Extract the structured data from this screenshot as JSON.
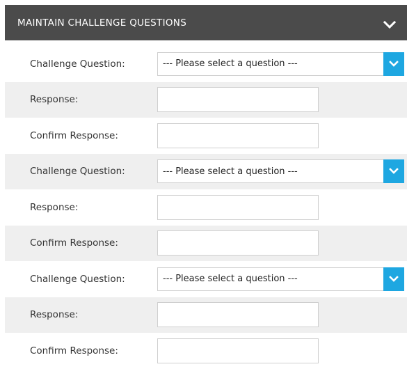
{
  "panel": {
    "title": "MAINTAIN CHALLENGE QUESTIONS",
    "collapse_icon": "chevron-down-icon"
  },
  "questions": [
    {
      "question_label": "Challenge Question:",
      "question_value": "--- Please select a question ---",
      "response_label": "Response:",
      "response_value": "",
      "confirm_label": "Confirm Response:",
      "confirm_value": ""
    },
    {
      "question_label": "Challenge Question:",
      "question_value": "--- Please select a question ---",
      "response_label": "Response:",
      "response_value": "",
      "confirm_label": "Confirm Response:",
      "confirm_value": ""
    },
    {
      "question_label": "Challenge Question:",
      "question_value": "--- Please select a question ---",
      "response_label": "Response:",
      "response_value": "",
      "confirm_label": "Confirm Response:",
      "confirm_value": ""
    }
  ],
  "colors": {
    "header_bg": "#4b4b4b",
    "accent": "#1ea7e1",
    "row_shade": "#efefef"
  }
}
